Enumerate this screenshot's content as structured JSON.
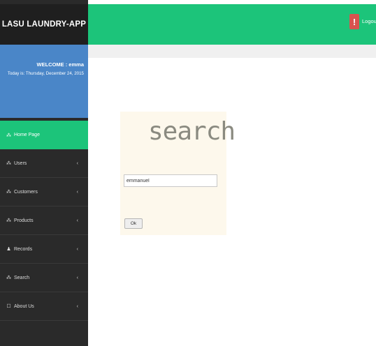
{
  "app": {
    "title": "LASU LAUNDRY-APP"
  },
  "user_panel": {
    "welcome": "WELCOME : emma",
    "today": "Today is: Thursday, December 24, 2015"
  },
  "topbar": {
    "logout_label": "Logout"
  },
  "sidebar": {
    "items": [
      {
        "label": "Home Page",
        "icon": "nodes-icon",
        "active": true
      },
      {
        "label": "Users",
        "icon": "nodes-icon",
        "chevron": "‹"
      },
      {
        "label": "Customers",
        "icon": "nodes-icon",
        "chevron": "‹"
      },
      {
        "label": "Products",
        "icon": "nodes-icon",
        "chevron": "‹"
      },
      {
        "label": "Records",
        "icon": "user-icon",
        "chevron": "‹"
      },
      {
        "label": "Search",
        "icon": "nodes-icon",
        "chevron": "‹"
      },
      {
        "label": "About Us",
        "icon": "square-icon",
        "chevron": "‹"
      }
    ]
  },
  "search": {
    "title": "search",
    "input_value": "emmanuel",
    "button_label": "Ok"
  },
  "colors": {
    "topbar": "#1cc47a",
    "sidebar": "#2a2a2a",
    "welcome_box": "#4a86c8",
    "logout_icon": "#d9534f",
    "panel": "#fdf8ec"
  }
}
